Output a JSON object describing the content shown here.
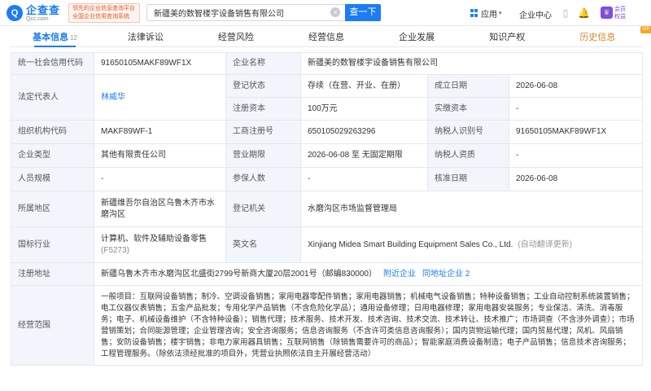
{
  "header": {
    "logo_name": "企查查",
    "logo_domain": "Qcc.com",
    "slogan": "领先的企业信息查询平台 全国企业信用查询系统",
    "search_value": "新疆美的数智楼宇设备销售有限公司",
    "search_clear": "⊗",
    "search_button": "查一下",
    "app_label": "应用",
    "enterprise_center": "企业中心",
    "vip_text": "会员 权益"
  },
  "tabs": [
    {
      "label": "基本信息",
      "count": "12"
    },
    {
      "label": "法律诉讼"
    },
    {
      "label": "经营风险"
    },
    {
      "label": "经营信息"
    },
    {
      "label": "企业发展"
    },
    {
      "label": "知识产权"
    },
    {
      "label": "历史信息",
      "vip": "VIP"
    }
  ],
  "info": {
    "credit_code_label": "统一社会信用代码",
    "credit_code": "91650105MAKF89WF1X",
    "company_name_label": "企业名称",
    "company_name": "新疆美的数智楼宇设备销售有限公司",
    "legal_rep_label": "法定代表人",
    "legal_rep": "林威华",
    "reg_status_label": "登记状态",
    "reg_status": "存续（在营、开业、在册）",
    "established_label": "成立日期",
    "established": "2026-06-08",
    "reg_capital_label": "注册资本",
    "reg_capital": "100万元",
    "paid_capital_label": "实缴资本",
    "paid_capital": "-",
    "org_code_label": "组织机构代码",
    "org_code": "MAKF89WF-1",
    "business_reg_no_label": "工商注册号",
    "business_reg_no": "650105029263296",
    "taxpayer_id_label": "纳税人识别号",
    "taxpayer_id": "91650105MAKF89WF1X",
    "company_type_label": "企业类型",
    "company_type": "其他有限责任公司",
    "term_label": "营业期限",
    "term": "2026-06-08 至 无固定期限",
    "taxpayer_qual_label": "纳税人资质",
    "taxpayer_qual": "-",
    "staff_size_label": "人员规模",
    "staff_size": "-",
    "insured_label": "参保人数",
    "insured": "-",
    "approval_date_label": "核准日期",
    "approval_date": "2026-06-08",
    "region_label": "所属地区",
    "region": "新疆维吾尔自治区乌鲁木齐市水磨沟区",
    "authority_label": "登记机关",
    "authority": "水磨沟区市场监督管理局",
    "industry_label": "国标行业",
    "industry": "计算机、软件及辅助设备零售",
    "industry_code": "(F5273)",
    "english_name_label": "英文名",
    "english_name": "Xinjiang Midea Smart Building Equipment Sales Co., Ltd.",
    "english_note": "(自动翻译更新)",
    "address_label": "注册地址",
    "address": "新疆乌鲁木齐市水磨沟区北盛街2799号新商大厦20层2001号（邮编830000）",
    "address_link1": "附近企业",
    "address_link2": "同地址企业 2",
    "scope_label": "经营范围",
    "scope": "一般项目：互联网设备销售；制冷、空调设备销售；家用电器零配件销售；家用电器销售；机械电气设备销售；特种设备销售；工业自动控制系统装置销售；电工仪器仪表销售；五金产品批发；专用化学产品销售（不含危险化学品）；通用设备修理；日用电器修理；家用电器安装服务；专业保洁、清洗、消毒服务；电子、机械设备维护（不含特种设备）；销售代理；技术服务、技术开发、技术咨询、技术交流、技术转让、技术推广；市场调查（不含涉外调查）；市场营销策划；合同能源管理；企业管理咨询；安全咨询服务；信息咨询服务（不含许可类信息咨询服务）；国内货物运输代理；国内贸易代理；风机、风扇销售；安防设备销售；楼宇销售；非电力家用器具销售；互联网销售（除销售需要许可的商品）；智能家庭消费设备制造；电子产品销售；信息技术咨询服务；工程管理服务。（除依法须经批准的项目外，凭营业执照依法自主开展经营活动）"
  }
}
